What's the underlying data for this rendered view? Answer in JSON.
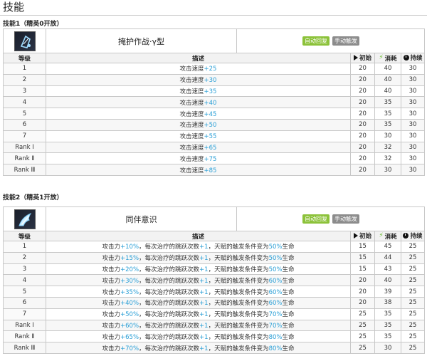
{
  "page": {
    "title": "技能"
  },
  "skill1": {
    "heading": "技能1（精英0开放）",
    "name": "掩护作战·γ型",
    "tags": [
      "自动回复",
      "手动触发"
    ],
    "columns": {
      "level": "等级",
      "desc": "描述",
      "init": "初始",
      "cost": "消耗",
      "duration": "持续"
    },
    "icon": "skill-shield-icon",
    "rows": [
      {
        "level": "1",
        "desc_pre": "攻击速度",
        "desc_val": "+25",
        "init": "20",
        "cost": "40",
        "duration": "30"
      },
      {
        "level": "2",
        "desc_pre": "攻击速度",
        "desc_val": "+30",
        "init": "20",
        "cost": "40",
        "duration": "30"
      },
      {
        "level": "3",
        "desc_pre": "攻击速度",
        "desc_val": "+35",
        "init": "20",
        "cost": "40",
        "duration": "30"
      },
      {
        "level": "4",
        "desc_pre": "攻击速度",
        "desc_val": "+40",
        "init": "20",
        "cost": "35",
        "duration": "30"
      },
      {
        "level": "5",
        "desc_pre": "攻击速度",
        "desc_val": "+45",
        "init": "20",
        "cost": "35",
        "duration": "30"
      },
      {
        "level": "6",
        "desc_pre": "攻击速度",
        "desc_val": "+50",
        "init": "20",
        "cost": "35",
        "duration": "30"
      },
      {
        "level": "7",
        "desc_pre": "攻击速度",
        "desc_val": "+55",
        "init": "20",
        "cost": "30",
        "duration": "30"
      },
      {
        "level": "Rank Ⅰ",
        "desc_pre": "攻击速度",
        "desc_val": "+65",
        "init": "20",
        "cost": "32",
        "duration": "30"
      },
      {
        "level": "Rank Ⅱ",
        "desc_pre": "攻击速度",
        "desc_val": "+75",
        "init": "20",
        "cost": "32",
        "duration": "30"
      },
      {
        "level": "Rank Ⅲ",
        "desc_pre": "攻击速度",
        "desc_val": "+85",
        "init": "20",
        "cost": "30",
        "duration": "30"
      }
    ]
  },
  "skill2": {
    "heading": "技能2（精英1开放）",
    "name": "同伴意识",
    "tags": [
      "自动回复",
      "手动触发"
    ],
    "columns": {
      "level": "等级",
      "desc": "描述",
      "init": "初始",
      "cost": "消耗",
      "duration": "持续"
    },
    "icon": "skill-wings-icon",
    "desc_parts": {
      "a": "攻击力",
      "b": "，每次治疗的跳跃次数",
      "c": "，天赋的触发条件变为",
      "d": "生命"
    },
    "rows": [
      {
        "level": "1",
        "atk": "+10%",
        "jump": "+1",
        "hp": "50%",
        "init": "15",
        "cost": "45",
        "duration": "25"
      },
      {
        "level": "2",
        "atk": "+15%",
        "jump": "+1",
        "hp": "50%",
        "init": "15",
        "cost": "44",
        "duration": "25"
      },
      {
        "level": "3",
        "atk": "+20%",
        "jump": "+1",
        "hp": "50%",
        "init": "15",
        "cost": "43",
        "duration": "25"
      },
      {
        "level": "4",
        "atk": "+30%",
        "jump": "+1",
        "hp": "60%",
        "init": "20",
        "cost": "40",
        "duration": "25"
      },
      {
        "level": "5",
        "atk": "+35%",
        "jump": "+1",
        "hp": "60%",
        "init": "20",
        "cost": "39",
        "duration": "25"
      },
      {
        "level": "6",
        "atk": "+40%",
        "jump": "+1",
        "hp": "60%",
        "init": "20",
        "cost": "38",
        "duration": "25"
      },
      {
        "level": "7",
        "atk": "+50%",
        "jump": "+1",
        "hp": "70%",
        "init": "25",
        "cost": "35",
        "duration": "25"
      },
      {
        "level": "Rank Ⅰ",
        "atk": "+60%",
        "jump": "+1",
        "hp": "70%",
        "init": "25",
        "cost": "35",
        "duration": "25"
      },
      {
        "level": "Rank Ⅱ",
        "atk": "+65%",
        "jump": "+1",
        "hp": "80%",
        "init": "25",
        "cost": "35",
        "duration": "25"
      },
      {
        "level": "Rank Ⅲ",
        "atk": "+70%",
        "jump": "+1",
        "hp": "80%",
        "init": "25",
        "cost": "30",
        "duration": "25"
      }
    ]
  },
  "colors": {
    "highlight": "#2a9fd6",
    "tag_green": "#8cc23a",
    "tag_gray": "#8c8c8c",
    "header_bg": "#f2f2f2"
  }
}
